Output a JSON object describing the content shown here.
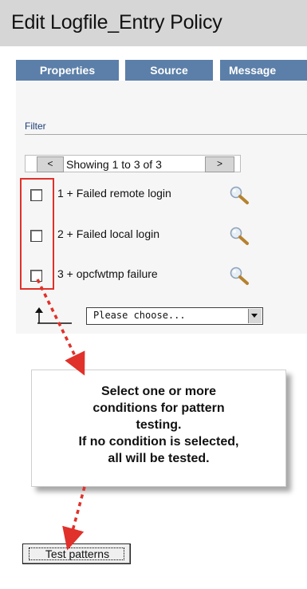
{
  "title": "Edit Logfile_Entry Policy",
  "tabs": [
    {
      "label": "Properties"
    },
    {
      "label": "Source"
    },
    {
      "label": "Message"
    }
  ],
  "filter": {
    "label": "Filter",
    "pager": {
      "prev_label": "<",
      "next_label": ">",
      "status_text": "Showing 1 to 3 of 3"
    },
    "conditions": [
      {
        "label": "1 + Failed remote login",
        "checked": false
      },
      {
        "label": "2 + Failed local login",
        "checked": false
      },
      {
        "label": "3 + opcfwtmp failure",
        "checked": false
      }
    ],
    "action_select": {
      "selected": "Please choose..."
    }
  },
  "callout": {
    "lines": [
      "Select one or more",
      "conditions for pattern",
      "testing.",
      "If no condition is selected,",
      "all will be tested."
    ]
  },
  "test_button": {
    "label": "Test patterns"
  },
  "colors": {
    "tab_background": "#5b7fa8",
    "callout_border": "#e0312a",
    "annotation_arrow": "#e0312a",
    "title_background": "#d6d6d6"
  },
  "icons": {
    "row_action": "magnifier-icon",
    "move_up": "up-arrow-icon",
    "select_dropdown": "chevron-down-icon"
  }
}
